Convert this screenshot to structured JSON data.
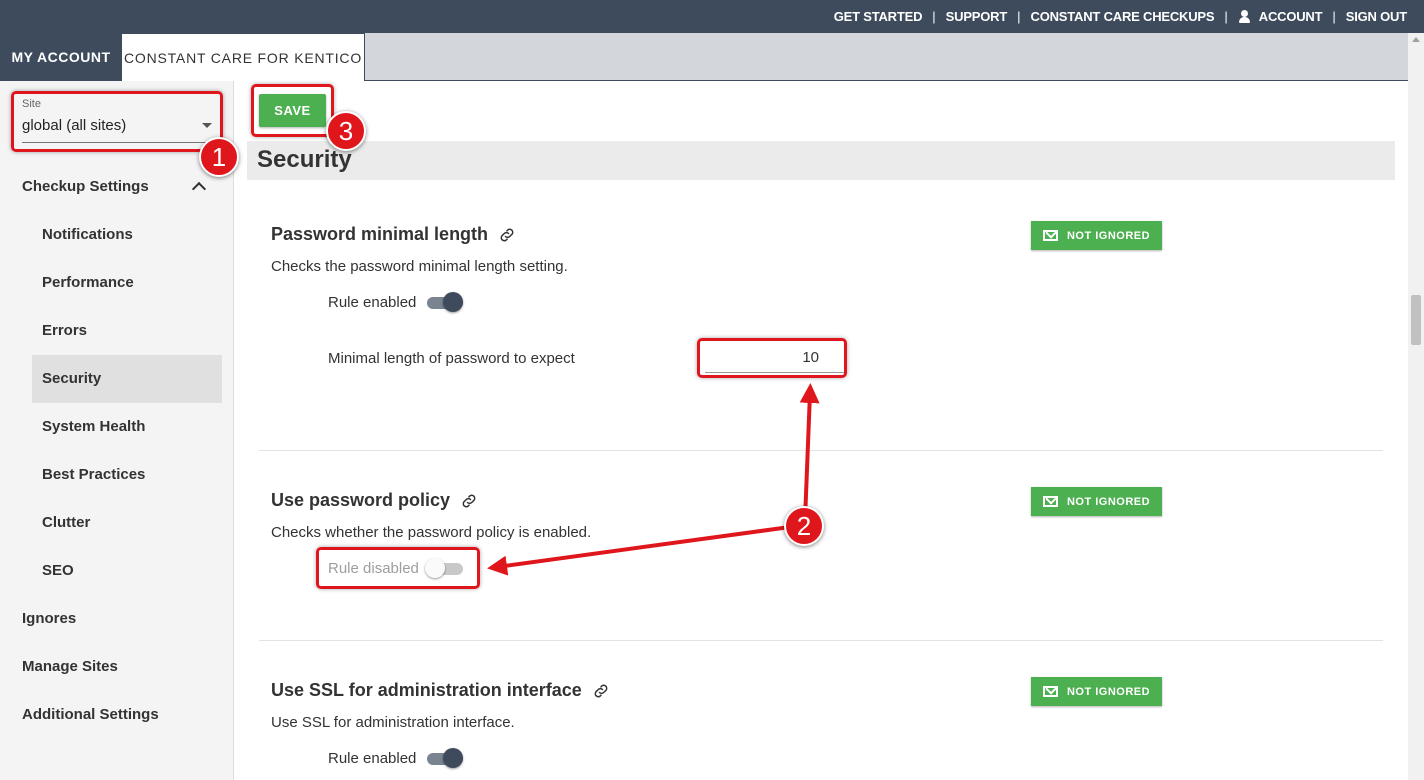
{
  "topnav": {
    "get_started": "GET STARTED",
    "support": "SUPPORT",
    "checkups": "CONSTANT CARE CHECKUPS",
    "account": "ACCOUNT",
    "sign_out": "SIGN OUT",
    "separator": "|"
  },
  "tabs": {
    "my_account": "MY ACCOUNT",
    "constant_care": "CONSTANT CARE FOR KENTICO"
  },
  "sidebar": {
    "site_label": "Site",
    "site_value": "global (all sites)",
    "checkup_settings": "Checkup Settings",
    "items": [
      "Notifications",
      "Performance",
      "Errors",
      "Security",
      "System Health",
      "Best Practices",
      "Clutter",
      "SEO"
    ],
    "active_item": "Security",
    "ignores": "Ignores",
    "manage_sites": "Manage Sites",
    "additional_settings": "Additional Settings"
  },
  "main": {
    "save_label": "SAVE",
    "section_title": "Security",
    "badge_label": "NOT IGNORED",
    "rules": [
      {
        "title": "Password minimal length",
        "description": "Checks the password minimal length setting.",
        "state_label": "Rule enabled",
        "enabled": true,
        "field_label": "Minimal length of password to expect",
        "field_value": "10"
      },
      {
        "title": "Use password policy",
        "description": "Checks whether the password policy is enabled.",
        "state_label": "Rule disabled",
        "enabled": false
      },
      {
        "title": "Use SSL for administration interface",
        "description": "Use SSL for administration interface.",
        "state_label": "Rule enabled",
        "enabled": true
      }
    ]
  },
  "annotations": {
    "marker1": "1",
    "marker2": "2",
    "marker3": "3"
  },
  "colors": {
    "header": "#3d4b5c",
    "accent_green": "#4caf50",
    "annotation_red": "#e0161d"
  }
}
